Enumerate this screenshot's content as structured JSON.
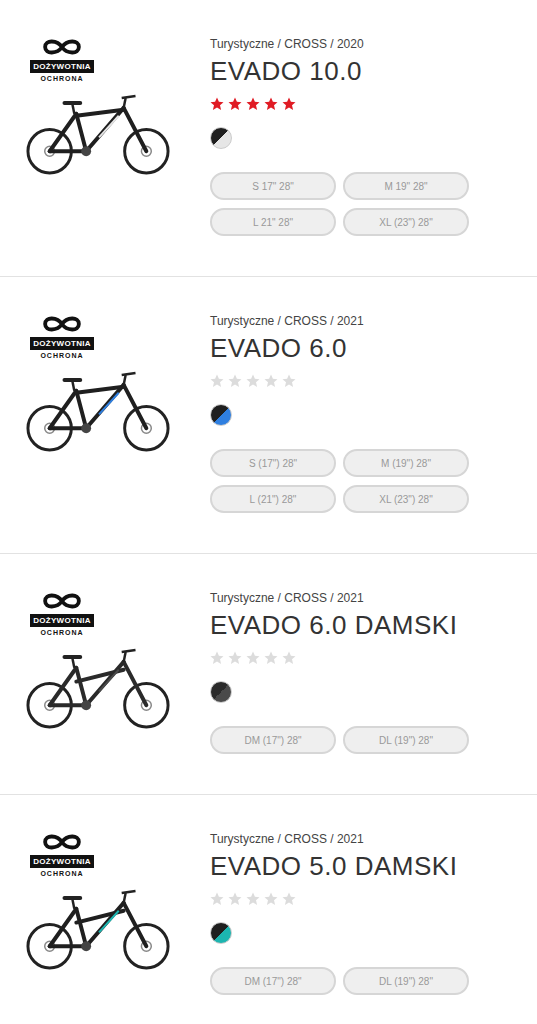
{
  "products": [
    {
      "badge": {
        "line1": "DOŻYWOTNIA",
        "line2": "OCHRONA"
      },
      "category": "Turystyczne / CROSS / 2020",
      "title": "EVADO 10.0",
      "stars": 5,
      "colors": [
        "#1f1f1f",
        "#e6e6e6"
      ],
      "kind": "mens",
      "sizes": [
        "S 17\" 28\"",
        "M 19\" 28\"",
        "L 21\" 28\"",
        "XL (23\") 28\""
      ]
    },
    {
      "badge": {
        "line1": "DOŻYWOTNIA",
        "line2": "OCHRONA"
      },
      "category": "Turystyczne / CROSS / 2021",
      "title": "EVADO 6.0",
      "stars": 0,
      "colors": [
        "#1f1f1f",
        "#2f7fe0"
      ],
      "kind": "mens",
      "sizes": [
        "S (17\") 28\"",
        "M (19\") 28\"",
        "L (21\") 28\"",
        "XL (23\") 28\""
      ]
    },
    {
      "badge": {
        "line1": "DOŻYWOTNIA",
        "line2": "OCHRONA"
      },
      "category": "Turystyczne / CROSS / 2021",
      "title": "EVADO 6.0 DAMSKI",
      "stars": 0,
      "colors": [
        "#2a2a2a",
        "#4a4a4a"
      ],
      "kind": "womens",
      "sizes": [
        "DM (17\") 28\"",
        "DL (19\") 28\""
      ]
    },
    {
      "badge": {
        "line1": "DOŻYWOTNIA",
        "line2": "OCHRONA"
      },
      "category": "Turystyczne / CROSS / 2021",
      "title": "EVADO 5.0 DAMSKI",
      "stars": 0,
      "colors": [
        "#1f1f1f",
        "#1cb5b0"
      ],
      "kind": "womens",
      "sizes": [
        "DM (17\") 28\"",
        "DL (19\") 28\""
      ]
    }
  ]
}
